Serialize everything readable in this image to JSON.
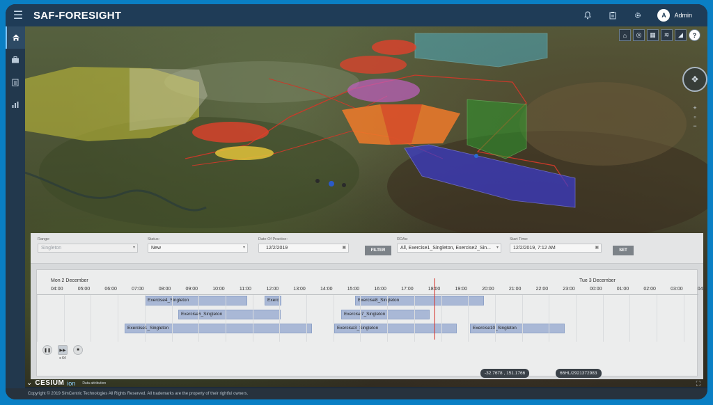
{
  "app": {
    "title": "SAF-FORESIGHT",
    "menu_icon": "hamburger-icon"
  },
  "topbar": {
    "icons": [
      "bell-icon",
      "clipboard-icon",
      "gear-icon"
    ],
    "user": {
      "initial": "A",
      "name": "Admin"
    }
  },
  "sidebar": {
    "items": [
      {
        "icon": "home-icon",
        "active": true
      },
      {
        "icon": "briefcase-icon",
        "active": false
      },
      {
        "icon": "clipboard-list-icon",
        "active": false
      },
      {
        "icon": "bar-chart-icon",
        "active": false
      }
    ]
  },
  "map_tools": {
    "help_label": "?"
  },
  "filters": {
    "range": {
      "label": "Range:",
      "value": "Singleton"
    },
    "status": {
      "label": "Status:",
      "value": "New"
    },
    "date": {
      "label": "Date Of Practice:",
      "value": "12/2/2019"
    },
    "filter_button": "FILTER",
    "rdas": {
      "label": "RDAs:",
      "value": "All, Exercise1_Singleton, Exercise2_Sin..."
    },
    "start_time": {
      "label": "Start Time:",
      "value": "12/2/2019, 7:12 AM"
    },
    "set_button": "SET"
  },
  "timeline": {
    "days": [
      {
        "label": "Mon 2 December"
      },
      {
        "label": "Tue 3 December"
      }
    ],
    "hours": [
      "04:00",
      "05:00",
      "06:00",
      "07:00",
      "08:00",
      "09:00",
      "10:00",
      "11:00",
      "12:00",
      "13:00",
      "14:00",
      "15:00",
      "16:00",
      "17:00",
      "18:00",
      "19:00",
      "20:00",
      "21:00",
      "22:00",
      "23:00",
      "00:00",
      "01:00",
      "02:00",
      "03:00",
      "04:00"
    ],
    "exercises": [
      {
        "name": "Exercise4_Singleton"
      },
      {
        "name": "Exercise6_Singleton"
      },
      {
        "name": "Exercise1_Singleton"
      },
      {
        "name": "Exerci"
      },
      {
        "name": "Exercise8_Singleton"
      },
      {
        "name": "Exercise7_Singleton"
      },
      {
        "name": "Exercise3_Singleton"
      },
      {
        "name": "Exercise10_Singleton"
      }
    ],
    "speed_label": "x 64"
  },
  "coords": {
    "latlon": "-32.7678 , 151.1766",
    "id": "66HL/2921372983"
  },
  "cesium": {
    "logo": "CESIUM",
    "ion": "ion",
    "attribution": "Data attribution"
  },
  "footer": {
    "copyright": "Copyright © 2019 SimCentric Technologies All Rights Reserved. All trademarks are the property of their rightful owners."
  }
}
